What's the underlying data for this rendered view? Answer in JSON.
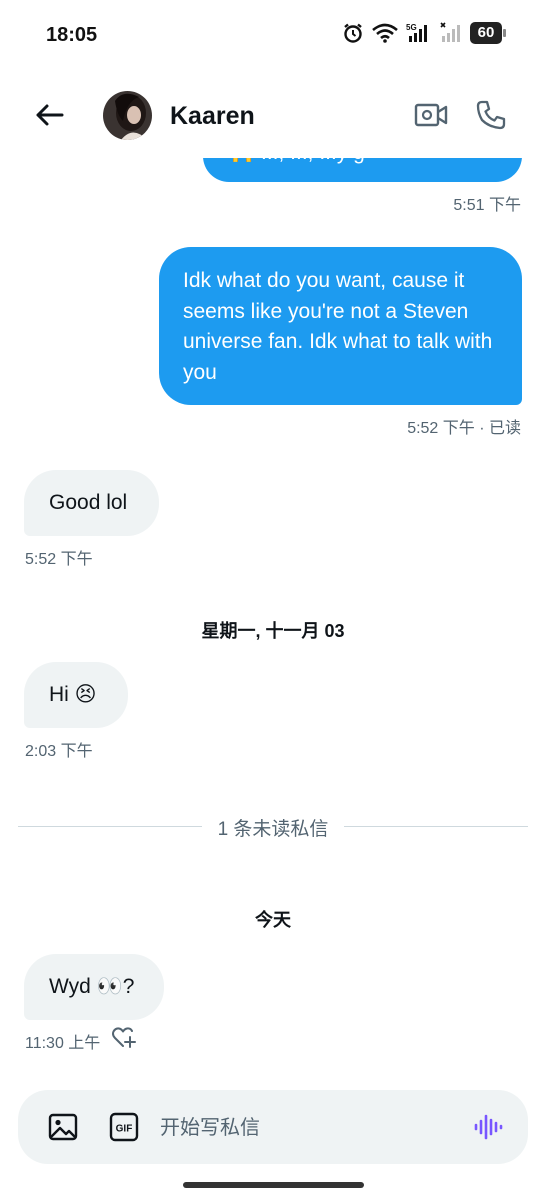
{
  "status_bar": {
    "time": "18:05",
    "network": "5G",
    "battery": "60"
  },
  "header": {
    "contact_name": "Kaaren",
    "back_icon": "back-arrow-icon",
    "video_icon": "video-camera-icon",
    "call_icon": "phone-icon"
  },
  "messages": [
    {
      "direction": "out",
      "text": "🙌 ..., ..., ...y g",
      "meta": "5:51 下午"
    },
    {
      "direction": "out",
      "text": "Idk what do you want, cause it seems like you're not a Steven universe fan. Idk what to talk with you",
      "meta": "5:52 下午 · 已读"
    },
    {
      "direction": "in",
      "text": "Good lol",
      "meta": "5:52 下午"
    },
    {
      "direction": "in",
      "text": "Hi 😣",
      "meta": "2:03 下午"
    },
    {
      "direction": "in",
      "text": "Wyd 👀?",
      "meta": "11:30 上午"
    }
  ],
  "separators": {
    "date_1": "星期一, 十一月 03",
    "unread": "1 条未读私信",
    "date_2": "今天"
  },
  "composer": {
    "placeholder": "开始写私信",
    "image_icon": "image-icon",
    "gif_label": "GIF",
    "voice_icon": "voice-waveform-icon"
  },
  "colors": {
    "outgoing_bubble": "#1d9bf0",
    "incoming_bubble": "#eff3f4",
    "meta_text": "#536471",
    "voice_accent": "#7856ff"
  }
}
